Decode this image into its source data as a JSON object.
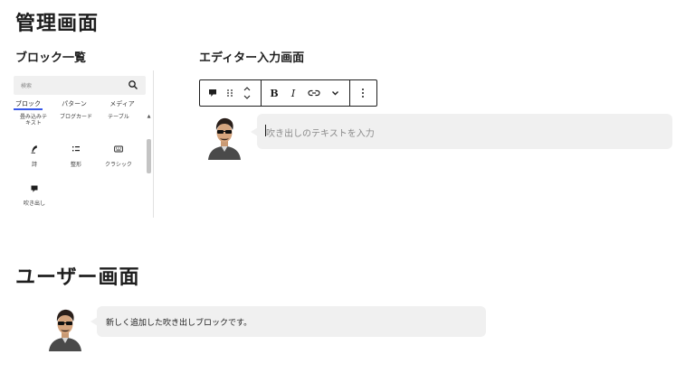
{
  "admin": {
    "title": "管理画面",
    "block_list": {
      "heading": "ブロック一覧",
      "search_placeholder": "検索",
      "tabs": [
        "ブロック",
        "パターン",
        "メディア"
      ],
      "row1": [
        "畳み込みテキスト",
        "ブログカード",
        "テーブル"
      ],
      "row2": [
        "詩",
        "整形",
        "クラシック"
      ],
      "row3": [
        "吹き出し"
      ]
    },
    "editor": {
      "heading": "エディター入力画面",
      "toolbar": {
        "bold": "B",
        "italic": "I"
      },
      "bubble_placeholder": "吹き出しのテキストを入力"
    }
  },
  "user": {
    "title": "ユーザー画面",
    "bubble_text": "新しく追加した吹き出しブロックです。"
  }
}
